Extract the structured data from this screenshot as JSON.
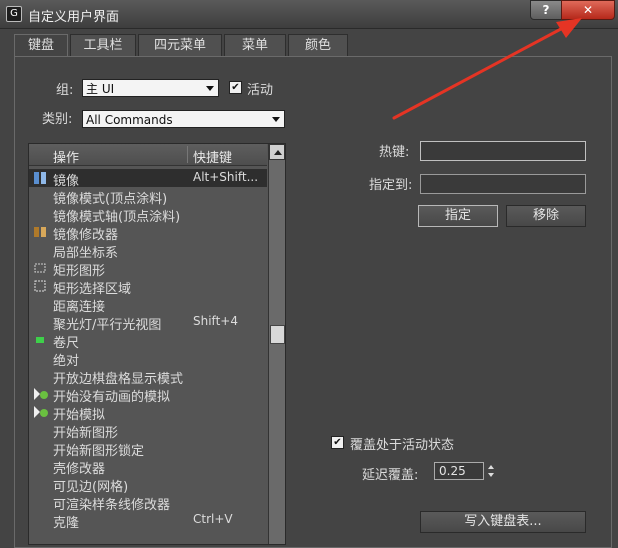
{
  "window": {
    "title": "自定义用户界面",
    "app_icon_glyph": "G"
  },
  "titlebar": {
    "help_label": "?",
    "close_label": "✕"
  },
  "tabs": [
    {
      "label": "键盘",
      "active": true
    },
    {
      "label": "工具栏",
      "active": false
    },
    {
      "label": "四元菜单",
      "active": false
    },
    {
      "label": "菜单",
      "active": false
    },
    {
      "label": "颜色",
      "active": false
    }
  ],
  "group": {
    "label": "组:",
    "value": "主 UI",
    "active_label": "活动",
    "active_checked": true
  },
  "category": {
    "label": "类别:",
    "value": "All Commands"
  },
  "list": {
    "headers": {
      "action": "操作",
      "shortcut": "快捷键"
    },
    "rows": [
      {
        "name": "镜像",
        "key": "Alt+Shift...",
        "icon": "mirror-icon",
        "selected": true
      },
      {
        "name": "镜像模式(顶点涂料)",
        "key": "",
        "icon": "",
        "selected": false
      },
      {
        "name": "镜像模式轴(顶点涂料)",
        "key": "",
        "icon": "",
        "selected": false
      },
      {
        "name": "镜像修改器",
        "key": "",
        "icon": "mirror-modifier-icon",
        "selected": false
      },
      {
        "name": "局部坐标系",
        "key": "",
        "icon": "",
        "selected": false
      },
      {
        "name": "矩形图形",
        "key": "",
        "icon": "rectangle-icon",
        "selected": false
      },
      {
        "name": "矩形选择区域",
        "key": "",
        "icon": "rect-select-icon",
        "selected": false
      },
      {
        "name": "距离连接",
        "key": "",
        "icon": "",
        "selected": false
      },
      {
        "name": "聚光灯/平行光视图",
        "key": "Shift+4",
        "icon": "",
        "selected": false
      },
      {
        "name": "卷尺",
        "key": "",
        "icon": "tape-icon",
        "selected": false
      },
      {
        "name": "绝对",
        "key": "",
        "icon": "",
        "selected": false
      },
      {
        "name": "开放边棋盘格显示模式",
        "key": "",
        "icon": "",
        "selected": false
      },
      {
        "name": "开始没有动画的模拟",
        "key": "",
        "icon": "play-gear-icon",
        "selected": false
      },
      {
        "name": "开始模拟",
        "key": "",
        "icon": "play-gear-icon",
        "selected": false
      },
      {
        "name": "开始新图形",
        "key": "",
        "icon": "",
        "selected": false
      },
      {
        "name": "开始新图形锁定",
        "key": "",
        "icon": "",
        "selected": false
      },
      {
        "name": "壳修改器",
        "key": "",
        "icon": "",
        "selected": false
      },
      {
        "name": "可见边(网格)",
        "key": "",
        "icon": "",
        "selected": false
      },
      {
        "name": "可渲染样条线修改器",
        "key": "",
        "icon": "",
        "selected": false
      },
      {
        "name": "克隆",
        "key": "Ctrl+V",
        "icon": "",
        "selected": false
      }
    ]
  },
  "hotkey": {
    "label": "热键:",
    "value": ""
  },
  "assigned_to": {
    "label": "指定到:",
    "value": ""
  },
  "buttons": {
    "assign": "指定",
    "remove": "移除",
    "write_keyboard": "写入键盘表..."
  },
  "override": {
    "label": "覆盖处于活动状态",
    "checked": true
  },
  "delay": {
    "label": "延迟覆盖:",
    "value": "0.25"
  },
  "colors": {
    "annotation_arrow": "#e53424",
    "close_button": "#c8392a",
    "panel_bg": "#444444"
  }
}
